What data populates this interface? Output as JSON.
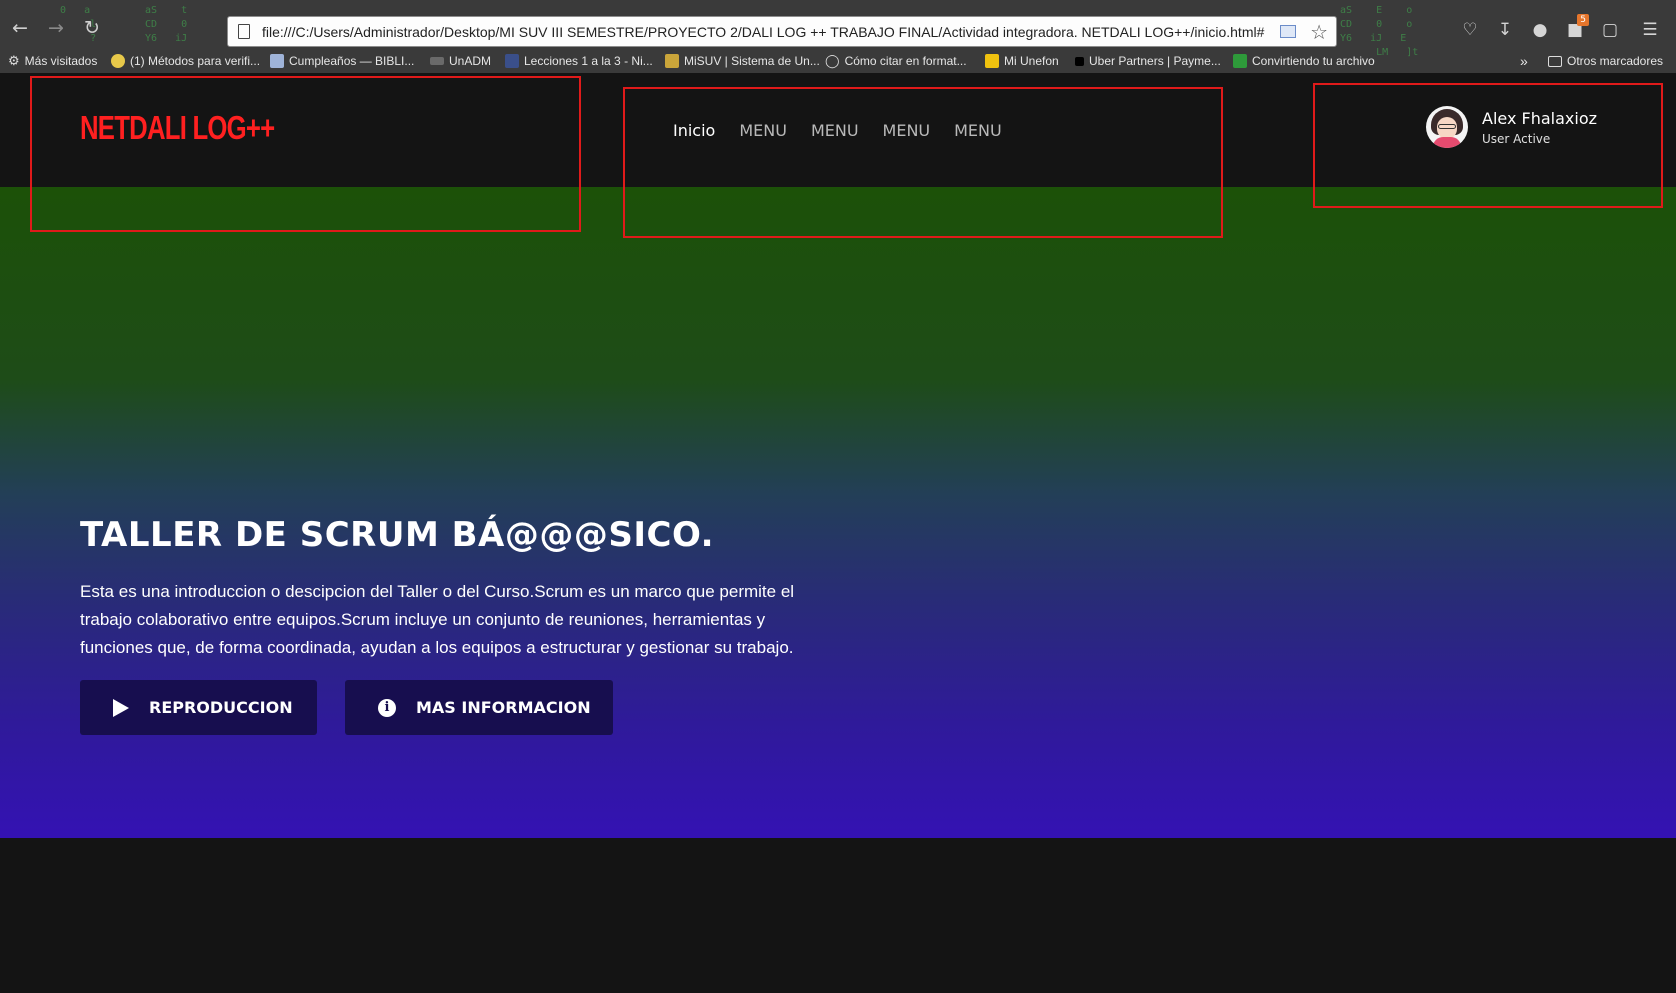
{
  "browser": {
    "url": "file:///C:/Users/Administrador/Desktop/MI SUV III SEMESTRE/PROYECTO 2/DALI LOG ++ TRABAJO FINAL/Actividad integradora. NETDALI LOG++/inicio.html#",
    "back_icon": "arrow-left-icon",
    "forward_icon": "arrow-right-icon",
    "reload_icon": "reload-icon",
    "badge_count": "5",
    "bookmarks": [
      "Más visitados",
      "(1) Métodos para verifi...",
      "Cumpleaños — BIBLI...",
      "UnADM",
      "Lecciones 1 a la 3 - Ni...",
      "MiSUV | Sistema de Un...",
      "Cómo citar en format...",
      "Mi Unefon",
      "Uber Partners | Payme...",
      "Convirtiendo tu archivo"
    ],
    "other_bookmarks": "Otros marcadores",
    "overflow": "»"
  },
  "site": {
    "logo": "NETDALI LOG++",
    "nav": [
      "Inicio",
      "MENU",
      "MENU",
      "MENU",
      "MENU"
    ],
    "user": {
      "name": "Alex Fhalaxioz",
      "status": "User Active"
    },
    "hero": {
      "title": "TALLER DE SCRUM BÁ@@@SICO.",
      "description": "Esta es una introduccion o descipcion del Taller o del Curso.Scrum es un marco que permite el trabajo colaborativo entre equipos.Scrum incluye un conjunto de reuniones, herramientas y funciones que, de forma coordinada, ayudan a los equipos a estructurar y gestionar su trabajo.",
      "play_label": "REPRODUCCION",
      "info_label": "MAS INFORMACION"
    }
  },
  "colors": {
    "logo": "#ff2020",
    "annotation_box": "#e01a1a",
    "button_bg": "#170e4f",
    "hero_top": "#1c5108",
    "hero_bottom": "#3412b3"
  }
}
